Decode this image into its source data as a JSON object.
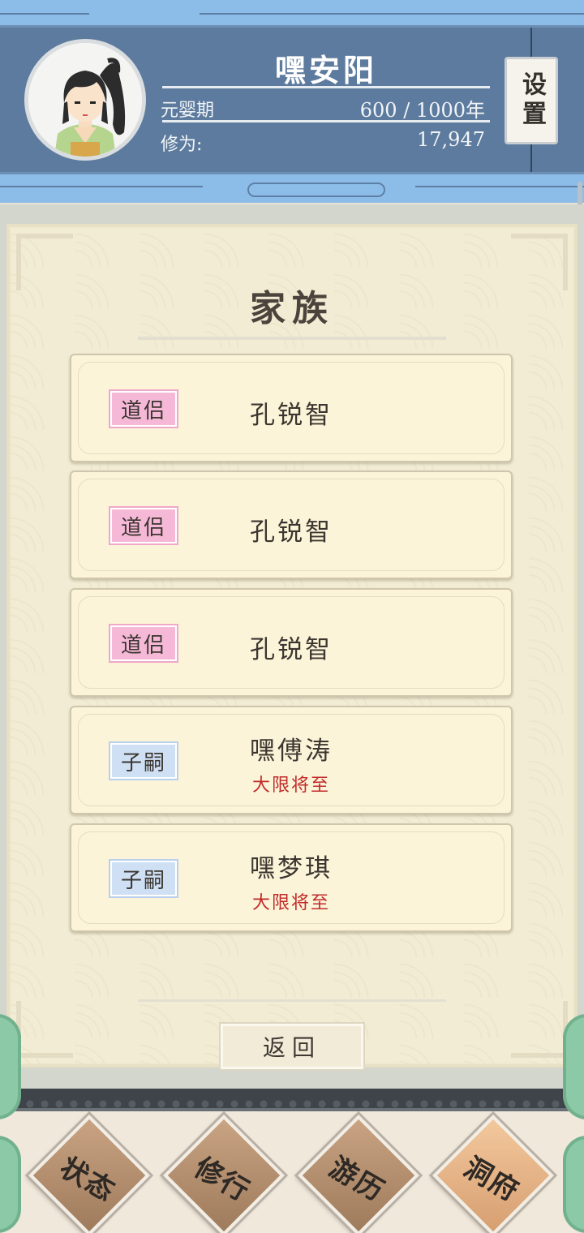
{
  "header": {
    "name": "嘿安阳",
    "realm": "元婴期",
    "age": "600 / 1000年",
    "cultivation_label": "修为:",
    "cultivation_value": "17,947",
    "settings_label": "设置"
  },
  "panel": {
    "title": "家族",
    "members": [
      {
        "badge": "道侣",
        "badge_color": "#f5b9d7",
        "name": "孔锐智",
        "status": ""
      },
      {
        "badge": "道侣",
        "badge_color": "#f5b9d7",
        "name": "孔锐智",
        "status": ""
      },
      {
        "badge": "道侣",
        "badge_color": "#f5b9d7",
        "name": "孔锐智",
        "status": ""
      },
      {
        "badge": "子嗣",
        "badge_color": "#cfe0f4",
        "name": "嘿傅涛",
        "status": "大限将至"
      },
      {
        "badge": "子嗣",
        "badge_color": "#cfe0f4",
        "name": "嘿梦琪",
        "status": "大限将至"
      }
    ],
    "back_label": "返回"
  },
  "nav": {
    "items": [
      {
        "label": "状态",
        "active": false
      },
      {
        "label": "修行",
        "active": false
      },
      {
        "label": "游历",
        "active": false
      },
      {
        "label": "洞府",
        "active": true
      }
    ]
  },
  "colors": {
    "header_bg": "#5d7b9e",
    "strip_bg": "#8cbde8",
    "panel_bg": "#f2ecd4",
    "status_red": "#c02a2a"
  }
}
